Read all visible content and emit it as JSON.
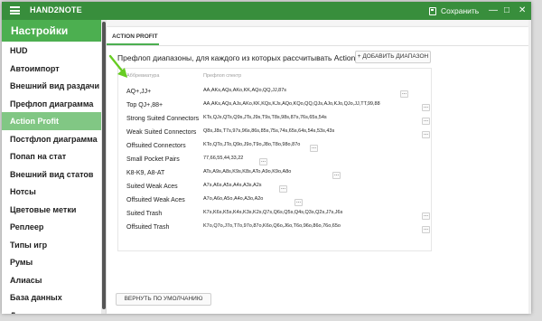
{
  "app": {
    "title": "HAND2NOTE",
    "save_label": "Сохранить",
    "minimize": "—",
    "maximize": "□",
    "close": "✕"
  },
  "sidebar": {
    "header": "Настройки",
    "items": [
      {
        "label": "HUD"
      },
      {
        "label": "Автоимпорт"
      },
      {
        "label": "Внешний вид раздачи"
      },
      {
        "label": "Префлоп диаграмма"
      },
      {
        "label": "Action Profit"
      },
      {
        "label": "Постфлоп диаграмма"
      },
      {
        "label": "Попап на стат"
      },
      {
        "label": "Внешний вид статов"
      },
      {
        "label": "Нотсы"
      },
      {
        "label": "Цветовые метки"
      },
      {
        "label": "Реплеер"
      },
      {
        "label": "Типы игр"
      },
      {
        "label": "Румы"
      },
      {
        "label": "Алиасы"
      },
      {
        "label": "База данных"
      },
      {
        "label": "Другие опции"
      }
    ],
    "active_index": 4
  },
  "main": {
    "tab_label": "ACTION PROFIT",
    "heading": "Префлоп диапазоны, для каждого из которых рассчитывать Action Profit",
    "add_button": "+ ДОБАВИТЬ ДИАПАЗОН",
    "table": {
      "col_abbr": "Аббревиатура",
      "col_spectrum": "Префлоп спектр",
      "rows": [
        {
          "name": "AQ+,JJ+",
          "range": "AA,AKs,AQs,AKo,KK,AQo,QQ,JJ,87s"
        },
        {
          "name": "Top QJ+,88+",
          "range": "AA,AKs,AQs,AJs,AKo,KK,KQs,KJs,AQo,KQo,QQ,QJs,AJo,KJo,QJo,JJ,TT,99,88"
        },
        {
          "name": "Strong Suited Connectors",
          "range": "KTs,QJs,QTs,Q9s,JTs,J9s,T9s,T8s,98s,87s,76s,65s,54s"
        },
        {
          "name": "Weak Suited Connectors",
          "range": "Q8s,J8s,T7s,97s,96s,86s,85s,75s,74s,65s,64s,54s,53s,43s"
        },
        {
          "name": "Offsuited Connectors",
          "range": "KTo,QTo,JTo,Q9o,J9o,T9o,J8o,T8o,98o,87o"
        },
        {
          "name": "Small Pocket Pairs",
          "range": "77,66,55,44,33,22"
        },
        {
          "name": "K8-K9, A8-AT",
          "range": "ATs,A9s,A8s,K9s,K8s,ATo,A9o,K9o,A8o"
        },
        {
          "name": "Suited Weak Aces",
          "range": "A7s,A6s,A5s,A4s,A3s,A2s"
        },
        {
          "name": "Offsuited Weak Aces",
          "range": "A7o,A6o,A5o,A4o,A3o,A2o"
        },
        {
          "name": "Suited Trash",
          "range": "K7s,K6s,K5s,K4s,K3s,K2s,Q7s,Q6s,Q5s,Q4s,Q3s,Q2s,J7s,J6s"
        },
        {
          "name": "Offsuited Trash",
          "range": "K7o,Q7o,J7o,T7o,97o,87o,K6o,Q6o,J6o,T6o,96o,86o,76o,65o"
        }
      ]
    },
    "reset_button": "ВЕРНУТЬ ПО УМОЛЧАНИЮ",
    "more_label": "..."
  },
  "colors": {
    "topbar": "#388e3c",
    "sidebar_header": "#4caf50",
    "active_item": "#81c784",
    "annotation_arrow": "#66cc22"
  }
}
